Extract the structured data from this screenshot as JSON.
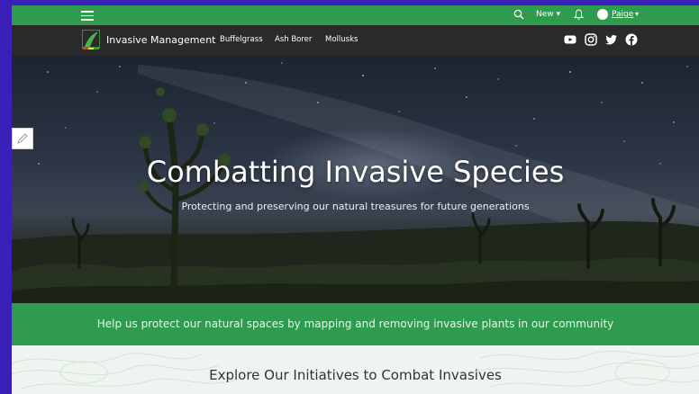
{
  "topbar": {
    "new_label": "New ▾",
    "user_label": "Paige",
    "user_caret": "▾"
  },
  "navbar": {
    "site_title": "Invasive Management",
    "links": [
      "Buffelgrass",
      "Ash Borer",
      "Mollusks"
    ],
    "social_icons": [
      "youtube-icon",
      "instagram-icon",
      "twitter-icon",
      "facebook-icon"
    ]
  },
  "hero": {
    "title": "Combatting Invasive Species",
    "subtitle": "Protecting and preserving our natural treasures for future generations"
  },
  "band": {
    "text": "Help us protect our natural spaces by mapping and removing invasive plants in our community"
  },
  "explore": {
    "title": "Explore Our Initiatives to Combat Invasives"
  },
  "colors": {
    "topbar": "#2e9b4e",
    "navbar": "#2a2a2a",
    "band": "#2e9b4e",
    "explore_bg": "#eef5f0"
  }
}
